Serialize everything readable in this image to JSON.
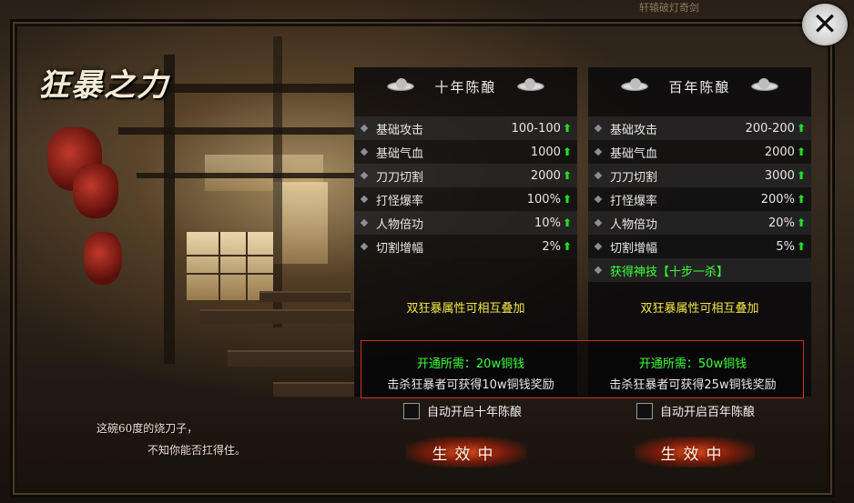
{
  "window": {
    "title": "狂暴之力",
    "top_ornament": "轩辕破灯奇剑"
  },
  "close_icon": "close-x-icon",
  "scene_quote": {
    "line1": "这碗60度的烧刀子，",
    "line2": "不知你能否扛得住。"
  },
  "panels": [
    {
      "title": "十年陈酿",
      "stats": [
        {
          "label": "基础攻击",
          "value": "100-100"
        },
        {
          "label": "基础气血",
          "value": "1000"
        },
        {
          "label": "刀刀切割",
          "value": "2000"
        },
        {
          "label": "打怪爆率",
          "value": "100%"
        },
        {
          "label": "人物倍功",
          "value": "10%"
        },
        {
          "label": "切割增幅",
          "value": "2%"
        }
      ],
      "stack_note": "双狂暴属性可相互叠加",
      "cost": "开通所需：20w铜钱",
      "reward": "击杀狂暴者可获得10w铜钱奖励",
      "auto_label": "自动开启十年陈酿",
      "button": "生效中"
    },
    {
      "title": "百年陈酿",
      "stats": [
        {
          "label": "基础攻击",
          "value": "200-200"
        },
        {
          "label": "基础气血",
          "value": "2000"
        },
        {
          "label": "刀刀切割",
          "value": "3000"
        },
        {
          "label": "打怪爆率",
          "value": "200%"
        },
        {
          "label": "人物倍功",
          "value": "20%"
        },
        {
          "label": "切割增幅",
          "value": "5%"
        }
      ],
      "special": "获得神技【十步一杀】",
      "stack_note": "双狂暴属性可相互叠加",
      "cost": "开通所需：50w铜钱",
      "reward": "击杀狂暴者可获得25w铜钱奖励",
      "auto_label": "自动开启百年陈酿",
      "button": "生效中"
    }
  ],
  "colors": {
    "stat_up_arrow": "#22e022",
    "special_text": "#3aff3a",
    "stack_note": "#f5e84a",
    "cost_text": "#3dff3d",
    "req_border": "#c43128"
  },
  "icons": {
    "stat_up": "up-arrow-icon",
    "row_bullet": "diamond-icon",
    "header_ornament": "cloud-ornament-icon"
  }
}
